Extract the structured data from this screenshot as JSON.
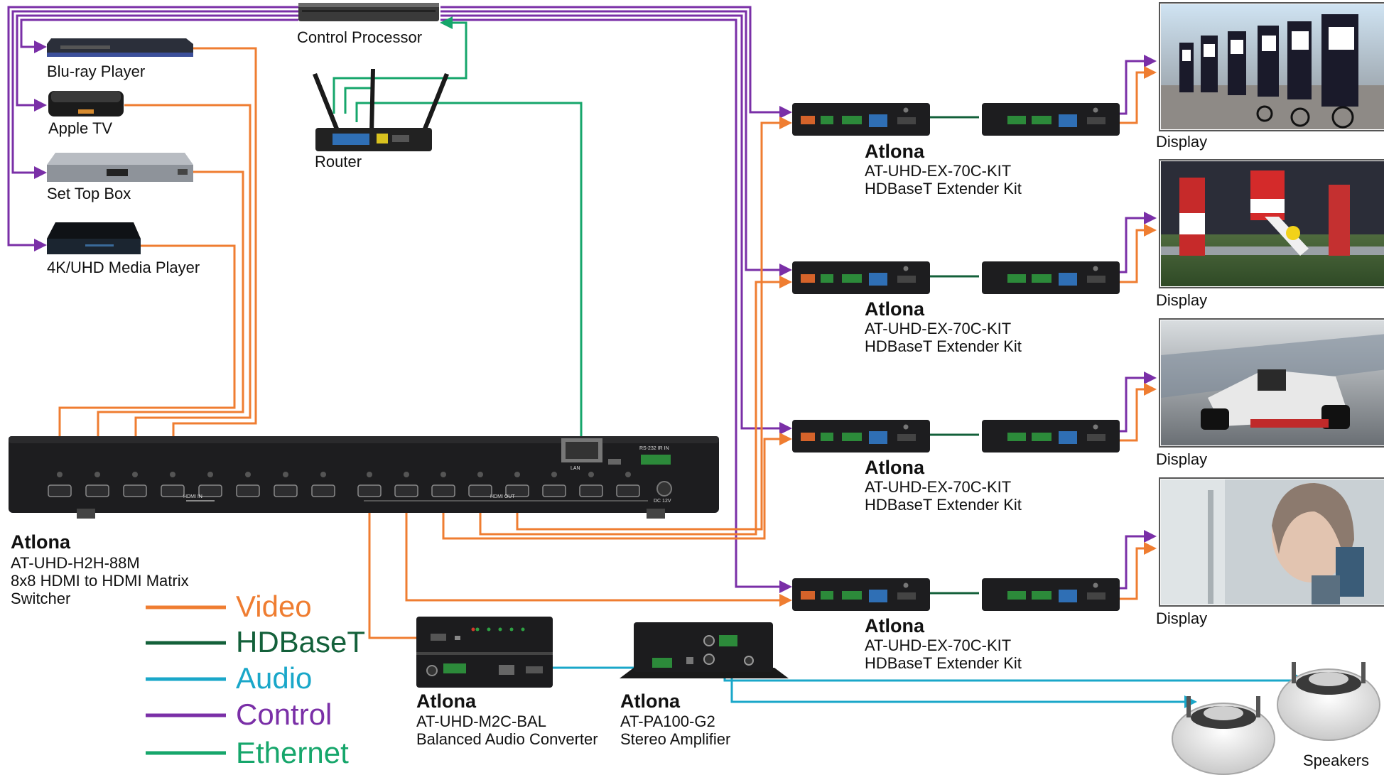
{
  "colors": {
    "video": "#ef7d31",
    "hdbaset": "#13603a",
    "audio": "#1aa7c9",
    "control": "#7a2fa7",
    "ethernet": "#16a66b"
  },
  "sources": {
    "bluray": "Blu-ray Player",
    "appletv": "Apple TV",
    "settop": "Set Top Box",
    "media": "4K/UHD Media Player"
  },
  "control_processor": "Control Processor",
  "router": "Router",
  "matrix": {
    "brand": "Atlona",
    "model": "AT-UHD-H2H-88M",
    "desc_1": "8x8 HDMI to HDMI Matrix",
    "desc_2": "Switcher",
    "port_text": {
      "hdmi_in": "HDMI IN",
      "hdmi_out": "HDMI OUT",
      "lan": "LAN",
      "dc": "DC 12V",
      "rs232": "RS-232  IR IN"
    }
  },
  "extenders": [
    {
      "brand": "Atlona",
      "model": "AT-UHD-EX-70C-KIT",
      "desc": "HDBaseT Extender Kit",
      "display": "Display"
    },
    {
      "brand": "Atlona",
      "model": "AT-UHD-EX-70C-KIT",
      "desc": "HDBaseT Extender Kit",
      "display": "Display"
    },
    {
      "brand": "Atlona",
      "model": "AT-UHD-EX-70C-KIT",
      "desc": "HDBaseT Extender Kit",
      "display": "Display"
    },
    {
      "brand": "Atlona",
      "model": "AT-UHD-EX-70C-KIT",
      "desc": "HDBaseT Extender Kit",
      "display": "Display"
    }
  ],
  "converter": {
    "brand": "Atlona",
    "model": "AT-UHD-M2C-BAL",
    "desc": "Balanced Audio Converter"
  },
  "amplifier": {
    "brand": "Atlona",
    "model": "AT-PA100-G2",
    "desc": "Stereo Amplifier"
  },
  "speakers": "Speakers",
  "legend": [
    {
      "label": "Video",
      "color": "#ef7d31"
    },
    {
      "label": "HDBaseT",
      "color": "#13603a"
    },
    {
      "label": "Audio",
      "color": "#1aa7c9"
    },
    {
      "label": "Control",
      "color": "#7a2fa7"
    },
    {
      "label": "Ethernet",
      "color": "#16a66b"
    }
  ]
}
